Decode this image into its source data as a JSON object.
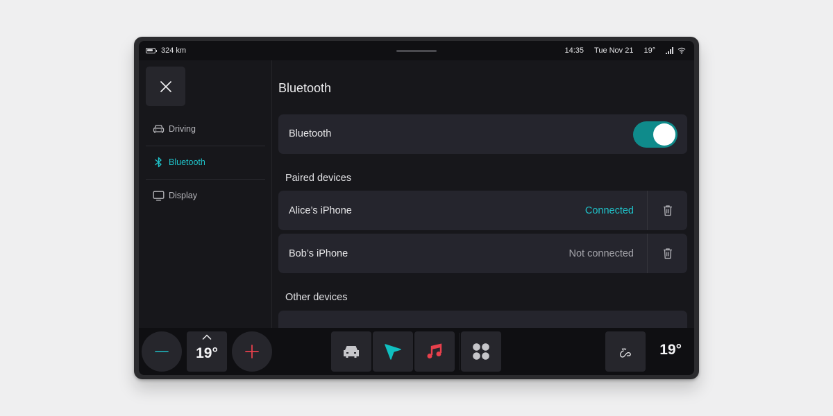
{
  "status_bar": {
    "battery_icon": "battery-icon",
    "range": "324 km",
    "time": "14:35",
    "date": "Tue Nov 21",
    "temperature": "19°",
    "signal_icon": "cellular-signal-icon",
    "wifi_icon": "wifi-icon"
  },
  "sidebar": {
    "close_icon": "close-icon",
    "items": [
      {
        "label": "Driving",
        "icon": "car-icon",
        "active": false
      },
      {
        "label": "Bluetooth",
        "icon": "bluetooth-icon",
        "active": true
      },
      {
        "label": "Display",
        "icon": "monitor-icon",
        "active": false
      }
    ]
  },
  "main": {
    "title": "Bluetooth",
    "bluetooth_toggle": {
      "label": "Bluetooth",
      "on": true
    },
    "paired_section_label": "Paired devices",
    "paired_devices": [
      {
        "name": "Alice’s iPhone",
        "status": "Connected",
        "status_color": "#1fc2c9"
      },
      {
        "name": "Bob’s iPhone",
        "status": "Not connected",
        "status_color": "#a4a4aa"
      }
    ],
    "other_section_label": "Other devices"
  },
  "dock": {
    "temp_decrease_icon": "minus-icon",
    "driver_temp": "19°",
    "temp_up_icon": "chevron-up-icon",
    "temp_increase_icon": "plus-icon",
    "apps": [
      {
        "name": "car",
        "icon": "car-icon"
      },
      {
        "name": "navigation",
        "icon": "navigation-arrow-icon"
      },
      {
        "name": "music",
        "icon": "music-note-icon"
      },
      {
        "name": "apps",
        "icon": "app-grid-icon"
      }
    ],
    "fan_icon": "ventilation-icon",
    "passenger_temp": "19°"
  },
  "colors": {
    "accent": "#1fc2c9",
    "toggle_on": "#0f8b8b",
    "music": "#e8404c",
    "increase": "#e8404c",
    "decrease": "#1fa8b0"
  }
}
